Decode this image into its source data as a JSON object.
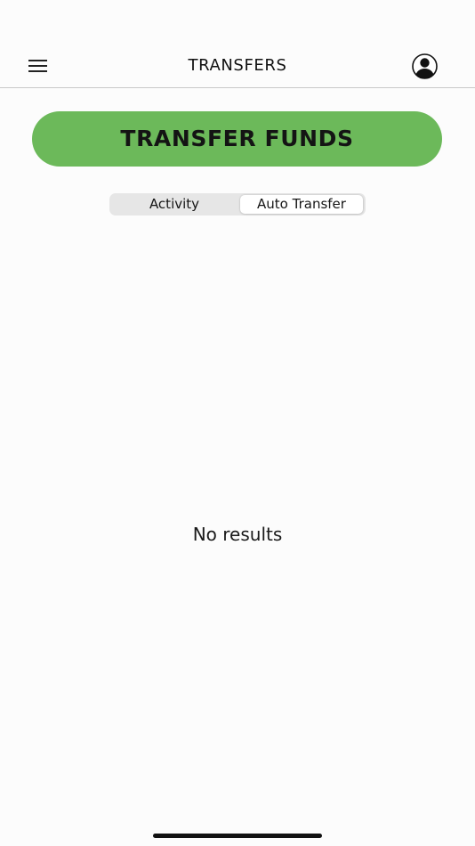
{
  "header": {
    "title": "TRANSFERS",
    "menu_icon": "hamburger-menu-icon",
    "profile_icon": "user-profile-icon"
  },
  "actions": {
    "transfer_funds_label": "TRANSFER FUNDS",
    "accent_color": "#6cb95a"
  },
  "tabs": {
    "items": [
      {
        "label": "Activity",
        "selected": false
      },
      {
        "label": "Auto Transfer",
        "selected": true
      }
    ]
  },
  "content": {
    "empty_message": "No results"
  }
}
